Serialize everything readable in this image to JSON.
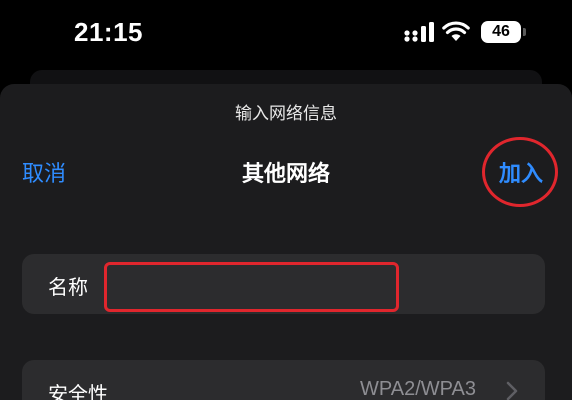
{
  "status_bar": {
    "time": "21:15",
    "battery_level": "46",
    "icons": [
      "signal-icon",
      "wifi-icon",
      "battery-icon"
    ]
  },
  "sheet": {
    "prompt": "输入网络信息",
    "nav": {
      "cancel_label": "取消",
      "title": "其他网络",
      "join_label": "加入"
    },
    "name_row": {
      "label": "名称",
      "value": "",
      "placeholder": ""
    },
    "security_row": {
      "label": "安全性",
      "value": "WPA2/WPA3"
    }
  },
  "colors": {
    "background": "#000000",
    "sheet": "#1c1c1e",
    "row": "#2c2c2e",
    "accent": "#2f8cff",
    "annotation": "#e0262d",
    "secondary_text": "#8e8e93"
  }
}
